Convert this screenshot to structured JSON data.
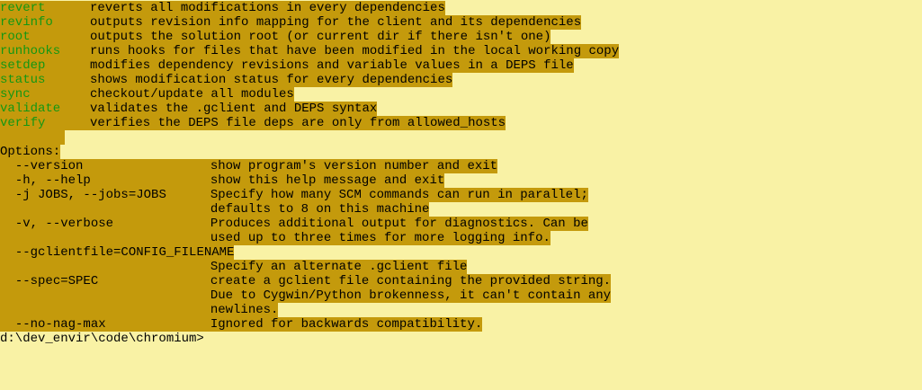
{
  "theme": {
    "background": "#F9F2A5",
    "highlight": "#C49A0C",
    "command_color": "#139713",
    "text_color": "#000000"
  },
  "commands": [
    {
      "name": "revert",
      "desc": "reverts all modifications in every dependencies"
    },
    {
      "name": "revinfo",
      "desc": "outputs revision info mapping for the client and its dependencies"
    },
    {
      "name": "root",
      "desc": "outputs the solution root (or current dir if there isn't one)"
    },
    {
      "name": "runhooks",
      "desc": "runs hooks for files that have been modified in the local working copy"
    },
    {
      "name": "setdep",
      "desc": "modifies dependency revisions and variable values in a DEPS file"
    },
    {
      "name": "status",
      "desc": "shows modification status for every dependencies"
    },
    {
      "name": "sync",
      "desc": "checkout/update all modules"
    },
    {
      "name": "validate",
      "desc": "validates the .gclient and DEPS syntax"
    },
    {
      "name": "verify",
      "desc": "verifies the DEPS file deps are only from allowed_hosts"
    }
  ],
  "options_header": "Options:",
  "options": [
    {
      "flag": "--version",
      "desc": "show program's version number and exit"
    },
    {
      "flag": "-h, --help",
      "desc": "show this help message and exit"
    },
    {
      "flag": "-j JOBS, --jobs=JOBS",
      "desc": "Specify how many SCM commands can run in parallel;"
    },
    {
      "flag": "",
      "desc": "defaults to 8 on this machine"
    },
    {
      "flag": "-v, --verbose",
      "desc": "Produces additional output for diagnostics. Can be"
    },
    {
      "flag": "",
      "desc": "used up to three times for more logging info."
    },
    {
      "flag": "--gclientfile=CONFIG_FILENAME",
      "desc": ""
    },
    {
      "flag": "",
      "desc": "Specify an alternate .gclient file"
    },
    {
      "flag": "--spec=SPEC",
      "desc": "create a gclient file containing the provided string."
    },
    {
      "flag": "",
      "desc": "Due to Cygwin/Python brokenness, it can't contain any"
    },
    {
      "flag": "",
      "desc": "newlines."
    },
    {
      "flag": "--no-nag-max",
      "desc": "Ignored for backwards compatibility."
    }
  ],
  "prompt": "d:\\dev_envir\\code\\chromium>"
}
